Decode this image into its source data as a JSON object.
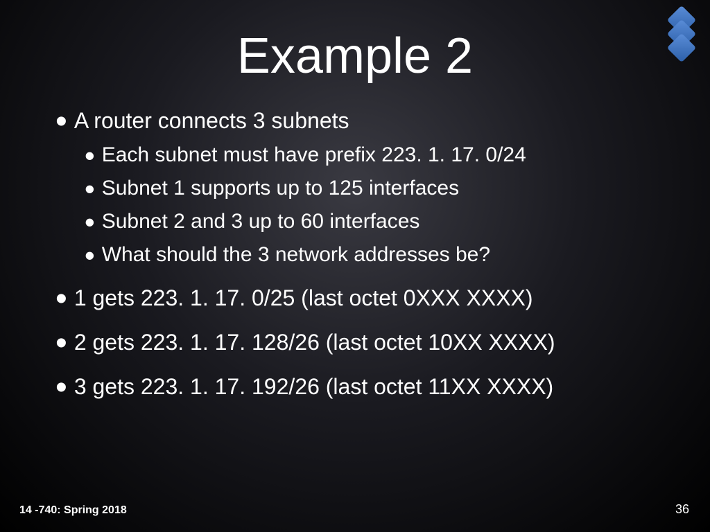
{
  "title": "Example 2",
  "bullets": {
    "b1": "A router connects 3 subnets",
    "b1a": "Each subnet must have prefix 223. 1. 17. 0/24",
    "b1b": "Subnet 1 supports up to 125 interfaces",
    "b1c": "Subnet 2 and 3 up to 60 interfaces",
    "b1d": "What should the 3 network addresses be?",
    "b2": "1 gets 223. 1. 17. 0/25 (last octet 0XXX XXXX)",
    "b3": "2 gets 223. 1. 17. 128/26 (last octet 10XX XXXX)",
    "b4": "3 gets 223. 1. 17. 192/26 (last octet 11XX XXXX)"
  },
  "footer": {
    "left": "14 -740: Spring 2018",
    "right": "36"
  }
}
